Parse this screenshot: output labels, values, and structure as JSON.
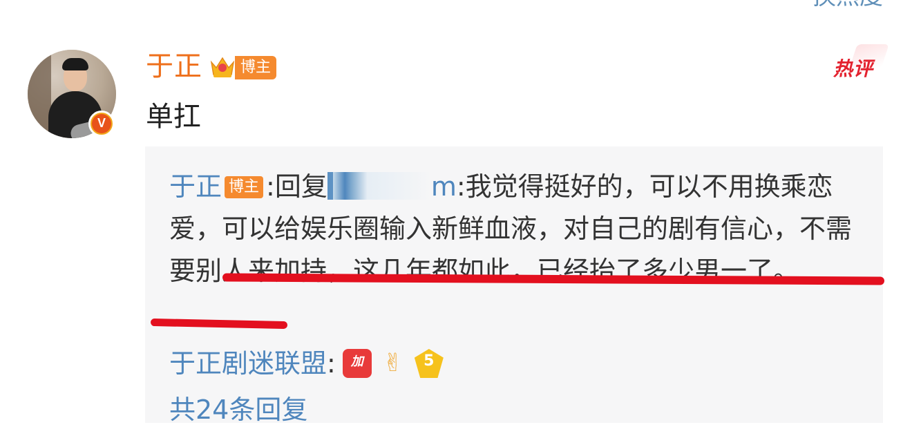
{
  "top_link": {
    "label": "换热度"
  },
  "comment": {
    "username": "于正",
    "author_tag": "博主",
    "hot_label": "热评",
    "text": "单扛"
  },
  "reply": {
    "author": "于正",
    "author_tag": "博主",
    "prefix": ":回复",
    "mention_tail": "m",
    "text_part1": ":我觉得挺好的，可以不用换乘恋爱，可以给娱乐圈输入新鲜血液，对自己的剧有信心，",
    "text_underlined": "不需要别人来加持，这几年都如此，已经抬了多少男一了",
    "text_end": "。"
  },
  "fan_reply": {
    "author": "于正剧迷联盟",
    "colon": ":",
    "emojis": [
      "encourage-emoji",
      "victory-hand-emoji",
      "five-stars-emoji"
    ]
  },
  "more_replies": {
    "label": "共24条回复"
  },
  "colors": {
    "username_orange": "#ee6f1b",
    "link_blue": "#4f86bd",
    "tag_orange": "#f58a2f",
    "hot_red": "#e3222f",
    "annotation_red": "#e3101f"
  }
}
